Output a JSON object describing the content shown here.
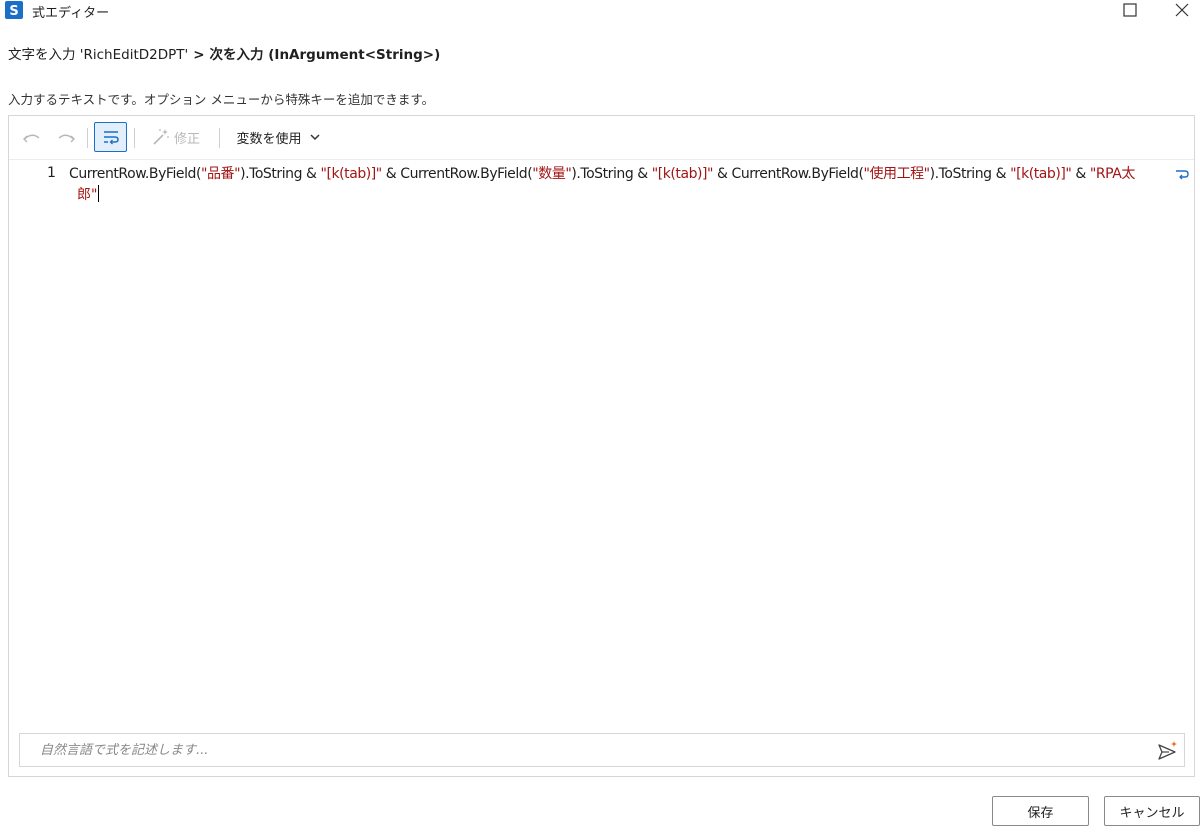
{
  "window": {
    "title": "式エディター",
    "icon": "uipath-studio-icon",
    "controls": [
      "maximize-icon",
      "close-icon"
    ]
  },
  "breadcrumb": {
    "parent": "文字を入力 'RichEditD2DPT'",
    "separator": ">",
    "current": "次を入力 (InArgument<String>)"
  },
  "description": "入力するテキストです。オプション メニューから特殊キーを追加できます。",
  "toolbar": {
    "fix_label": "修正",
    "variables_label": "変数を使用",
    "icons": [
      "undo-icon",
      "redo-icon",
      "word-wrap-icon",
      "magic-wand-icon",
      "chevron-down-icon"
    ]
  },
  "editor": {
    "line_number": "1",
    "tokens": [
      {
        "t": "CurrentRow.ByField(",
        "s": false
      },
      {
        "t": "\"品番\"",
        "s": true
      },
      {
        "t": ").ToString & ",
        "s": false
      },
      {
        "t": "\"[k(tab)]\"",
        "s": true
      },
      {
        "t": " & CurrentRow.ByField(",
        "s": false
      },
      {
        "t": "\"数量\"",
        "s": true
      },
      {
        "t": ").ToString & ",
        "s": false
      },
      {
        "t": "\"[k(tab)]\"",
        "s": true
      },
      {
        "t": " & CurrentRow.ByField(",
        "s": false
      },
      {
        "t": "\"使用工程\"",
        "s": true
      },
      {
        "t": ").ToString & ",
        "s": false
      },
      {
        "t": "\"[k(tab)]\"",
        "s": true
      },
      {
        "t": " & ",
        "s": false
      },
      {
        "t": "\"RPA太",
        "s": true
      }
    ],
    "wrapped_tail": "郎\"",
    "colors": {
      "string": "#a31515",
      "text": "#1f1f1f"
    }
  },
  "nl_input": {
    "placeholder": "自然言語で式を記述します..."
  },
  "footer": {
    "save_label": "保存",
    "cancel_label": "キャンセル"
  },
  "colors": {
    "accent": "#1a6fc9",
    "border": "#d6d6d6"
  }
}
